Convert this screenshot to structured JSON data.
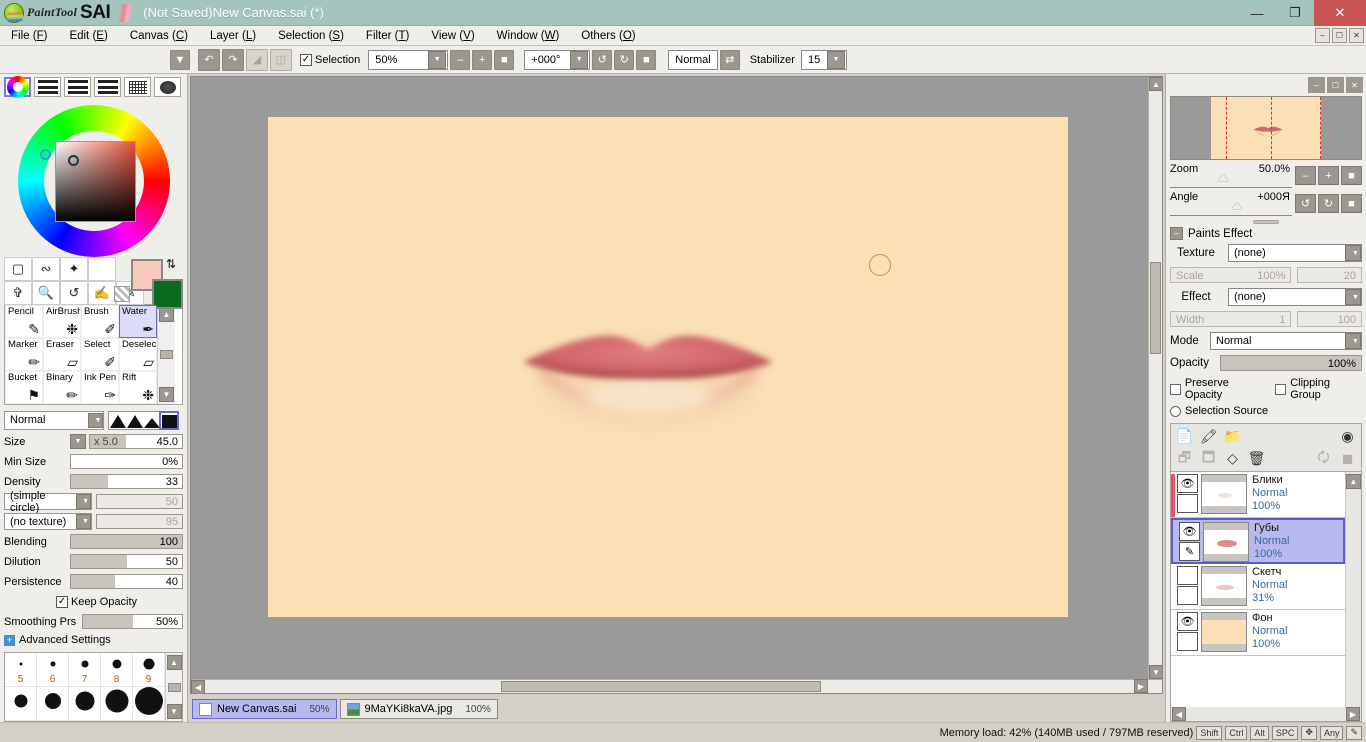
{
  "app": {
    "brand_paint": "PaintTool",
    "brand_sai": "SAI",
    "title": "(Not Saved)New Canvas.sai (*)"
  },
  "window_controls": {
    "minimize": "—",
    "maximize": "❐",
    "close": "✕"
  },
  "menu": {
    "items": [
      {
        "label": "File",
        "key": "F"
      },
      {
        "label": "Edit",
        "key": "E"
      },
      {
        "label": "Canvas",
        "key": "C"
      },
      {
        "label": "Layer",
        "key": "L"
      },
      {
        "label": "Selection",
        "key": "S"
      },
      {
        "label": "Filter",
        "key": "T"
      },
      {
        "label": "View",
        "key": "V"
      },
      {
        "label": "Window",
        "key": "W"
      },
      {
        "label": "Others",
        "key": "O"
      }
    ],
    "right_buttons": [
      "minimize-panel",
      "restore-panel",
      "close-panel"
    ]
  },
  "optionbar": {
    "undo_icon": "undo-icon",
    "redo_icon": "redo-icon",
    "fit_icon": "fit-icon",
    "mirror_icon": "mirror-icon",
    "selection_label": "Selection",
    "selection_checked": true,
    "zoom_value": "50%",
    "zoom_out": "–",
    "zoom_in": "+",
    "zoom_reset": "■",
    "angle_value": "+000°",
    "rotate_ccw": "↺",
    "rotate_cw": "↻",
    "rotate_reset": "■",
    "view_mode": "Normal",
    "flip_icon": "flip-icon",
    "stabilizer_label": "Stabilizer",
    "stabilizer_value": "15"
  },
  "left_panel": {
    "color_modes": [
      "wheel-icon",
      "rgb-bars-icon",
      "hsv-bars-icon",
      "swatch-list-icon",
      "grid-icon",
      "gradient-icon"
    ],
    "selected_color_mode": 0,
    "foreground_color": "#f7c9bd",
    "background_color": "#0a6b1e",
    "select_icons": [
      "marquee-icon",
      "lasso-icon",
      "magic-wand-icon",
      "blank-1",
      "blank-2"
    ],
    "nav_icons": [
      "move-icon",
      "zoom-icon",
      "rotate-icon",
      "hand-icon",
      "eyedropper-icon"
    ],
    "tools": [
      {
        "name": "Pencil",
        "glyph": "✎"
      },
      {
        "name": "AirBrush",
        "glyph": "❉"
      },
      {
        "name": "Brush",
        "glyph": "✐"
      },
      {
        "name": "Water",
        "glyph": "✒",
        "selected": true
      },
      {
        "name": "Marker",
        "glyph": "✏"
      },
      {
        "name": "Eraser",
        "glyph": "▱"
      },
      {
        "name": "Select",
        "glyph": "✐"
      },
      {
        "name": "Deselect",
        "glyph": "▱"
      },
      {
        "name": "Bucket",
        "glyph": "⚑"
      },
      {
        "name": "Binary",
        "glyph": "✏"
      },
      {
        "name": "Ink Pen",
        "glyph": "✑"
      },
      {
        "name": "Rift",
        "glyph": "❉"
      }
    ],
    "brush": {
      "blend_mode": "Normal",
      "shapes": [
        "soft-tip",
        "medium-tip",
        "hard-tip",
        "flat-tip"
      ],
      "selected_shape": 3,
      "size_label": "Size",
      "size_multiplier": "x 5.0",
      "size_value": "45.0",
      "min_size_label": "Min Size",
      "min_size_value": "0%",
      "density_label": "Density",
      "density_value": "33",
      "density_pct": 33,
      "tip_shape": "(simple circle)",
      "tip_shape_value": "50",
      "texture": "(no texture)",
      "texture_value": "95",
      "blending_label": "Blending",
      "blending_value": "100",
      "blending_pct": 100,
      "dilution_label": "Dilution",
      "dilution_value": "50",
      "dilution_pct": 50,
      "persistence_label": "Persistence",
      "persistence_value": "40",
      "persistence_pct": 40,
      "keep_opacity_label": "Keep Opacity",
      "keep_opacity_checked": true,
      "smoothing_label": "Smoothing Prs",
      "smoothing_value": "50%",
      "smoothing_pct": 50,
      "advanced_label": "Advanced Settings"
    },
    "size_presets_top": [
      {
        "num": "5",
        "dot": 3
      },
      {
        "num": "6",
        "dot": 5
      },
      {
        "num": "7",
        "dot": 7
      },
      {
        "num": "8",
        "dot": 9
      },
      {
        "num": "9",
        "dot": 11
      }
    ],
    "size_presets_bottom": [
      {
        "dot": 13
      },
      {
        "dot": 16
      },
      {
        "dot": 19
      },
      {
        "dot": 23
      },
      {
        "dot": 28
      }
    ]
  },
  "canvas": {
    "background_color": "#fae0b4",
    "workspace_color": "#9a9a9a",
    "artwork": "lips-illustration"
  },
  "tabs": [
    {
      "name": "New Canvas.sai",
      "zoom": "50%",
      "active": true,
      "icon": "document-icon"
    },
    {
      "name": "9MaYKi8kaVA.jpg",
      "zoom": "100%",
      "active": false,
      "icon": "image-icon"
    }
  ],
  "right_panel": {
    "panel_buttons": [
      "minimize-icon",
      "restore-icon",
      "close-icon"
    ],
    "navigator": {
      "zoom_label": "Zoom",
      "zoom_value": "50.0%",
      "angle_label": "Angle",
      "angle_value": "+000Я",
      "zoom_out": "–",
      "zoom_in": "+",
      "zoom_reset": "■",
      "rotate_ccw": "↺",
      "rotate_cw": "↻",
      "rotate_reset": "■"
    },
    "paints_effect": {
      "section_title": "Paints Effect",
      "texture_label": "Texture",
      "texture_value": "(none)",
      "scale_label": "Scale",
      "scale_value": "100%",
      "scale_num": "20",
      "effect_label": "Effect",
      "effect_value": "(none)",
      "width_label": "Width",
      "width_value": "1",
      "width_num": "100"
    },
    "layer_props": {
      "mode_label": "Mode",
      "mode_value": "Normal",
      "opacity_label": "Opacity",
      "opacity_value": "100%",
      "preserve_opacity_label": "Preserve Opacity",
      "clipping_group_label": "Clipping Group",
      "selection_source_label": "Selection Source"
    },
    "layer_tools_row1": [
      "new-layer-icon",
      "new-linework-layer-icon",
      "new-folder-icon",
      "layer-mask-icon"
    ],
    "layer_tools_row2": [
      "duplicate-down-icon",
      "merge-down-icon",
      "clear-layer-icon",
      "delete-layer-icon",
      "transfer-icon",
      "merge-icon"
    ],
    "layers": [
      {
        "name": "Блики",
        "mode": "Normal",
        "opacity": "100%",
        "visible": true,
        "selected": false,
        "marked": true,
        "thumb": "highlights"
      },
      {
        "name": "Губы",
        "mode": "Normal",
        "opacity": "100%",
        "visible": true,
        "selected": true,
        "marked": false,
        "thumb": "lips"
      },
      {
        "name": "Скетч",
        "mode": "Normal",
        "opacity": "31%",
        "visible": false,
        "selected": false,
        "marked": false,
        "thumb": "sketch"
      },
      {
        "name": "Фон",
        "mode": "Normal",
        "opacity": "100%",
        "visible": true,
        "selected": false,
        "marked": false,
        "thumb": "background"
      }
    ]
  },
  "status": {
    "memory_text": "Memory load: 42% (140MB used / 797MB reserved)",
    "modifiers": [
      "Shift",
      "Ctrl",
      "Alt",
      "SPC",
      "✥",
      "Any"
    ],
    "pen_icon": "pen-icon"
  }
}
